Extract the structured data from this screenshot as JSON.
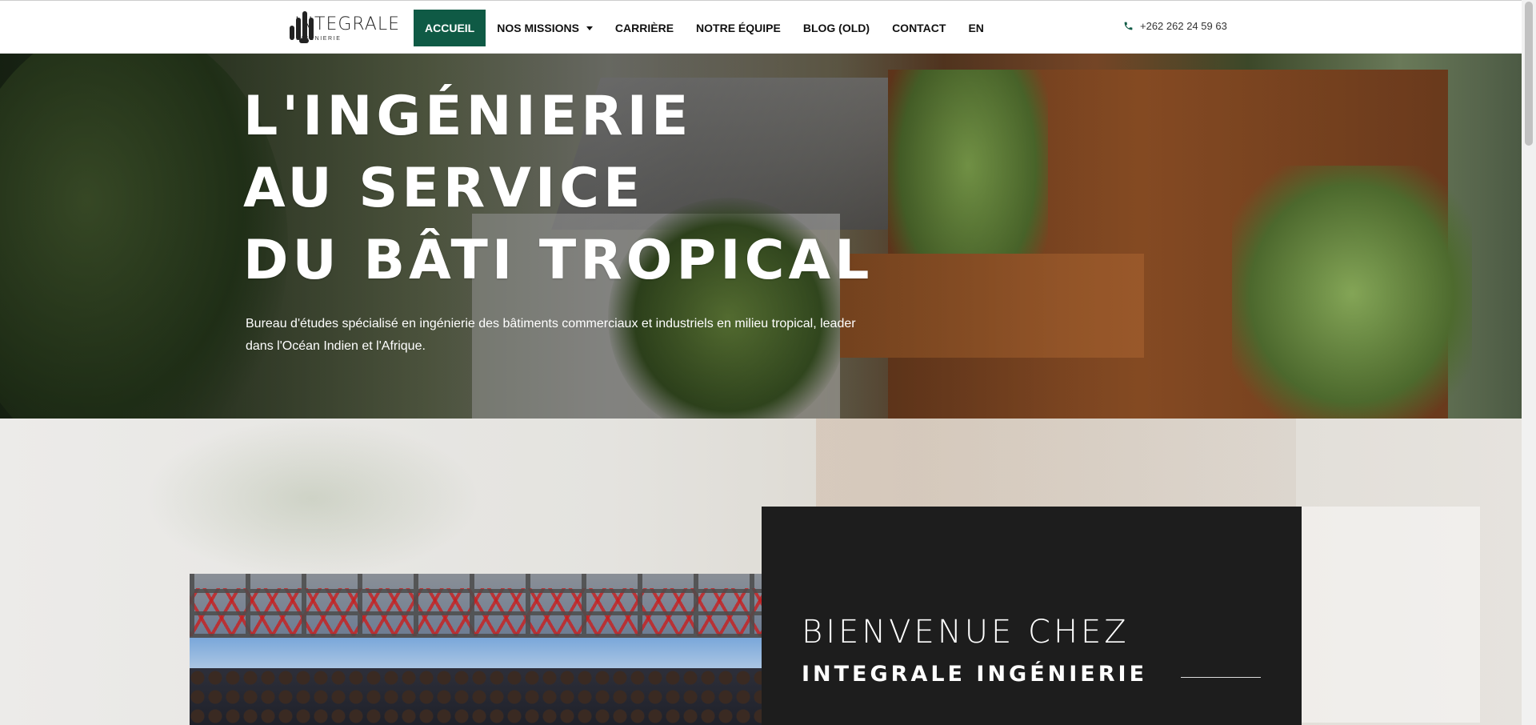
{
  "header": {
    "logo": {
      "name": "INTEGRALE",
      "sub": "INGENIERIE"
    },
    "nav": [
      {
        "label": "Accueil",
        "active": true
      },
      {
        "label": "Nos missions",
        "dropdown": true
      },
      {
        "label": "Carrière"
      },
      {
        "label": "Notre équipe"
      },
      {
        "label": "Blog (old)"
      },
      {
        "label": "Contact"
      },
      {
        "label": "EN"
      }
    ],
    "phone": {
      "icon": "phone-icon",
      "number": "+262 262 24 59 63"
    }
  },
  "hero": {
    "title_lines": [
      "L'INGÉNIERIE",
      "AU SERVICE",
      "DU BÂTI TROPICAL"
    ],
    "subtitle": "Bureau d'études spécialisé en ingénierie des bâtiments commerciaux et industriels en milieu tropical, leader dans l'Océan Indien et l'Afrique."
  },
  "welcome": {
    "line1": "BIENVENUE CHEZ",
    "line2": "INTEGRALE INGÉNIERIE"
  },
  "colors": {
    "accent": "#0f5a45",
    "dark_panel": "#1d1d1d"
  }
}
